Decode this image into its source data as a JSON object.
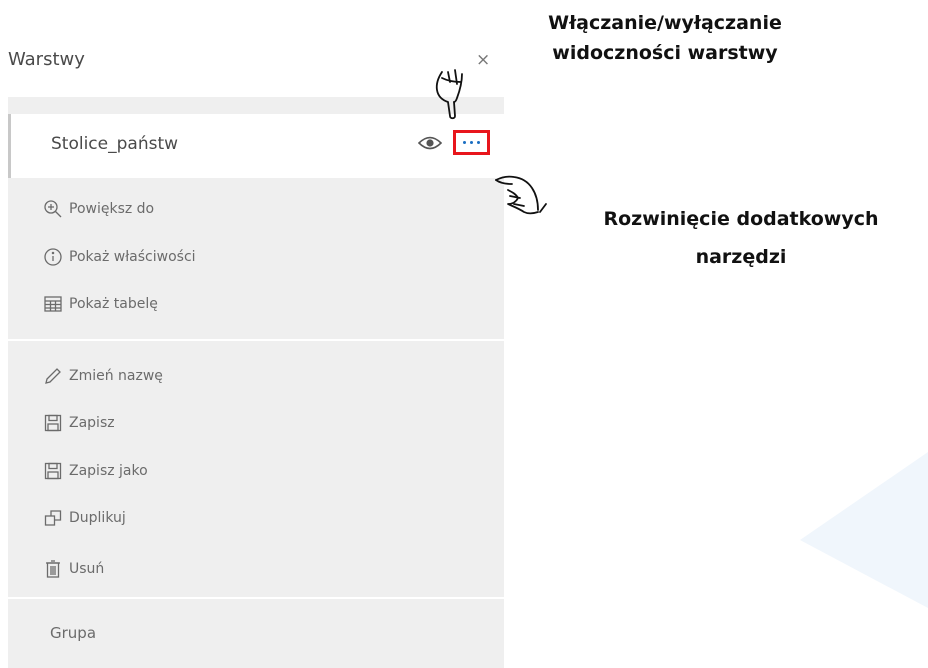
{
  "panel": {
    "title": "Warstwy",
    "close_symbol": "×"
  },
  "layer": {
    "name": "Stolice_państw",
    "visibility_icon": "eye-icon",
    "more_icon": "ellipsis-icon"
  },
  "menu": {
    "group1": [
      {
        "label": "Powiększ do",
        "icon": "zoom-in-icon"
      },
      {
        "label": "Pokaż właściwości",
        "icon": "info-icon"
      },
      {
        "label": "Pokaż tabelę",
        "icon": "table-icon"
      }
    ],
    "group2": [
      {
        "label": "Zmień nazwę",
        "icon": "pencil-icon"
      },
      {
        "label": "Zapisz",
        "icon": "save-icon"
      },
      {
        "label": "Zapisz jako",
        "icon": "save-as-icon"
      },
      {
        "label": "Duplikuj",
        "icon": "duplicate-icon"
      },
      {
        "label": "Usuń",
        "icon": "trash-icon"
      }
    ],
    "group3_label": "Grupa"
  },
  "annotations": {
    "top_line1": "Włączanie/wyłączanie",
    "top_line2": "widoczności warstwy",
    "right_line1": "Rozwinięcie dodatkowych",
    "right_line2": "narzędzi"
  },
  "colors": {
    "highlight_border": "#e8161c",
    "panel_bg": "#efefef",
    "dots": "#1a6ec2"
  }
}
